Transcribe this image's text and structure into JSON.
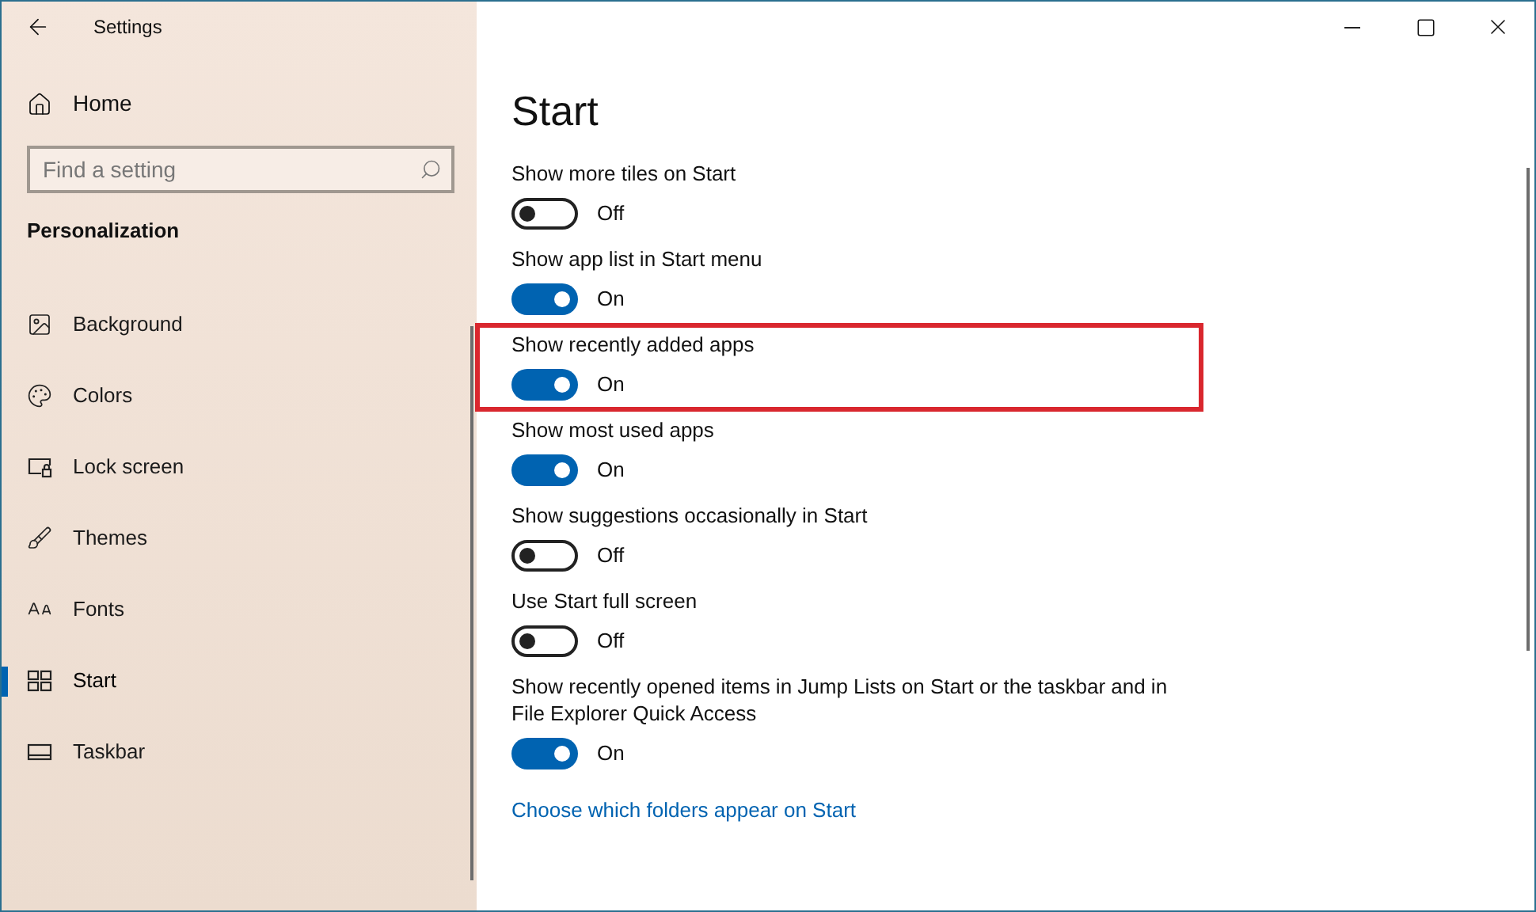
{
  "window": {
    "title": "Settings"
  },
  "sidebar": {
    "home": "Home",
    "search": {
      "placeholder": "Find a setting"
    },
    "section": "Personalization",
    "items": [
      {
        "label": "Background",
        "selected": false
      },
      {
        "label": "Colors",
        "selected": false
      },
      {
        "label": "Lock screen",
        "selected": false
      },
      {
        "label": "Themes",
        "selected": false
      },
      {
        "label": "Fonts",
        "selected": false
      },
      {
        "label": "Start",
        "selected": true
      },
      {
        "label": "Taskbar",
        "selected": false
      }
    ]
  },
  "page": {
    "title": "Start",
    "settings": [
      {
        "label": "Show more tiles on Start",
        "on": false,
        "state": "Off",
        "highlighted": false
      },
      {
        "label": "Show app list in Start menu",
        "on": true,
        "state": "On",
        "highlighted": false
      },
      {
        "label": "Show recently added apps",
        "on": true,
        "state": "On",
        "highlighted": true
      },
      {
        "label": "Show most used apps",
        "on": true,
        "state": "On",
        "highlighted": false
      },
      {
        "label": "Show suggestions occasionally in Start",
        "on": false,
        "state": "Off",
        "highlighted": false
      },
      {
        "label": "Use Start full screen",
        "on": false,
        "state": "Off",
        "highlighted": false
      },
      {
        "label": "Show recently opened items in Jump Lists on Start or the taskbar and in File Explorer Quick Access",
        "on": true,
        "state": "On",
        "highlighted": false
      }
    ],
    "link": "Choose which folders appear on Start"
  }
}
